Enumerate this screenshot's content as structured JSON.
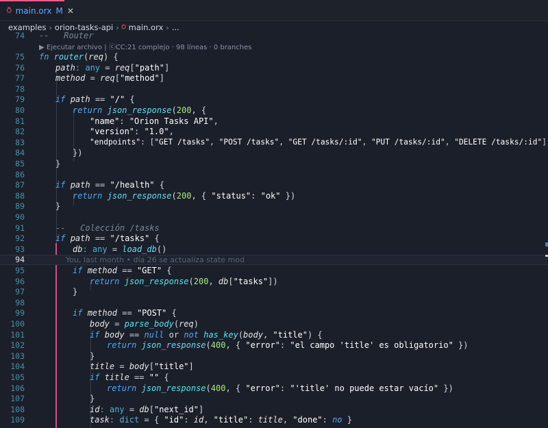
{
  "tab": {
    "icon_glyph": "⍥",
    "file_name": "main.orx",
    "modified_flag": "M",
    "close_glyph": "✕"
  },
  "breadcrumb": {
    "items": [
      "examples",
      "orion-tasks-api",
      "main.orx",
      "..."
    ],
    "file_icon_glyph": "⍥"
  },
  "code_lens": "▶ Ejecutar archivo | ⓒCC:21 complejo · 98 líneas · 0 branches",
  "blame": "You, last month • día 26 se actualiza state mod",
  "lines": [
    {
      "n": "74"
    },
    {
      "n": "75"
    },
    {
      "n": "76"
    },
    {
      "n": "77"
    },
    {
      "n": "78"
    },
    {
      "n": "79"
    },
    {
      "n": "80"
    },
    {
      "n": "81"
    },
    {
      "n": "82"
    },
    {
      "n": "83"
    },
    {
      "n": "84"
    },
    {
      "n": "85"
    },
    {
      "n": "86"
    },
    {
      "n": "87"
    },
    {
      "n": "88"
    },
    {
      "n": "89"
    },
    {
      "n": "90"
    },
    {
      "n": "91"
    },
    {
      "n": "92"
    },
    {
      "n": "93"
    },
    {
      "n": "94"
    },
    {
      "n": "95"
    },
    {
      "n": "96"
    },
    {
      "n": "97"
    },
    {
      "n": "98"
    },
    {
      "n": "99"
    },
    {
      "n": "100"
    },
    {
      "n": "101"
    },
    {
      "n": "102"
    },
    {
      "n": "103"
    },
    {
      "n": "104"
    },
    {
      "n": "105"
    },
    {
      "n": "106"
    },
    {
      "n": "107"
    },
    {
      "n": "108"
    },
    {
      "n": "109"
    }
  ],
  "code": {
    "l74": "--   Router",
    "l75": [
      "fn",
      "router",
      "(",
      "req",
      ") {"
    ],
    "l76": [
      "path",
      ": ",
      "any",
      " = ",
      "req",
      "[",
      "\"path\"",
      "]"
    ],
    "l77": [
      "method",
      " = ",
      "req",
      "[",
      "\"method\"",
      "]"
    ],
    "l79": [
      "if",
      "path",
      " == ",
      "\"/\"",
      " {"
    ],
    "l80": [
      "return",
      "json_response",
      "(",
      "200",
      ", {"
    ],
    "l81": [
      "\"name\"",
      ": ",
      "\"Orion Tasks API\"",
      ","
    ],
    "l82": [
      "\"version\"",
      ": ",
      "\"1.0\"",
      ","
    ],
    "l83": [
      "\"endpoints\"",
      ": [",
      "\"GET /tasks\"",
      ", ",
      "\"POST /tasks\"",
      ", ",
      "\"GET /tasks/:id\"",
      ", ",
      "\"PUT /tasks/:id\"",
      ", ",
      "\"DELETE /tasks/:id\"",
      "]"
    ],
    "l84": "})",
    "l85": "}",
    "l87": [
      "if",
      "path",
      " == ",
      "\"/health\"",
      " {"
    ],
    "l88": [
      "return",
      "json_response",
      "(",
      "200",
      ", { ",
      "\"status\"",
      ": ",
      "\"ok\"",
      " })"
    ],
    "l89": "}",
    "l91": "--   Colección /tasks",
    "l92": [
      "if",
      "path",
      " == ",
      "\"/tasks\"",
      " {"
    ],
    "l93": [
      "db",
      ": ",
      "any",
      " = ",
      "load_db",
      "()"
    ],
    "l95": [
      "if",
      "method",
      " == ",
      "\"GET\"",
      " {"
    ],
    "l96": [
      "return",
      "json_response",
      "(",
      "200",
      ", ",
      "db",
      "[",
      "\"tasks\"",
      "])"
    ],
    "l97": "}",
    "l99": [
      "if",
      "method",
      " == ",
      "\"POST\"",
      " {"
    ],
    "l100": [
      "body",
      " = ",
      "parse_body",
      "(",
      "req",
      ")"
    ],
    "l101": [
      "if",
      "body",
      " == ",
      "null",
      " or ",
      "not",
      " ",
      "has_key",
      "(",
      "body",
      ", ",
      "\"title\"",
      ") {"
    ],
    "l102": [
      "return",
      "json_response",
      "(",
      "400",
      ", { ",
      "\"error\"",
      ": ",
      "\"el campo 'title' es obligatorio\"",
      " })"
    ],
    "l103": "}",
    "l104": [
      "title",
      " = ",
      "body",
      "[",
      "\"title\"",
      "]"
    ],
    "l105": [
      "if",
      "title",
      " == ",
      "\"\"",
      " {"
    ],
    "l106": [
      "return",
      "json_response",
      "(",
      "400",
      ", { ",
      "\"error\"",
      ": ",
      "\"'title' no puede estar vacío\"",
      " })"
    ],
    "l107": "}",
    "l108": [
      "id",
      ": ",
      "any",
      " = ",
      "db",
      "[",
      "\"next_id\"",
      "]"
    ],
    "l109": [
      "task",
      ": ",
      "dict",
      " = { ",
      "\"id\"",
      ": ",
      "id",
      ", ",
      "\"title\"",
      ": ",
      "title",
      ", ",
      "\"done\"",
      ": ",
      "no",
      " }"
    ]
  },
  "colors": {
    "background": "#1b1f2a",
    "keyword": "#4fa9f0",
    "function": "#5fe0ee",
    "number": "#a8e87a",
    "string": "#ffffff",
    "comment": "#7c8696",
    "tab_accent": "#ff5a8a",
    "modified": "#62a8ff",
    "scope_marker": "#d94b8a"
  }
}
